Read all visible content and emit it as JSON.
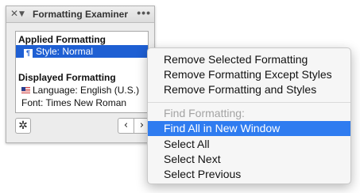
{
  "palette": {
    "title": "Formatting Examiner",
    "close_glyph": "✕",
    "collapse_glyph": "▼",
    "more_glyph": "•••",
    "applied_heading": "Applied Formatting",
    "applied_items": [
      {
        "label": "Style: Normal",
        "icon": "paragraph-style-icon",
        "selected": true
      }
    ],
    "displayed_heading": "Displayed Formatting",
    "displayed_items": [
      {
        "label": "Language: English (U.S.)",
        "icon": "us-flag-icon"
      },
      {
        "label": "Font: Times New Roman"
      }
    ],
    "gear_glyph": "✲",
    "prev_glyph": "‹",
    "next_glyph": "›"
  },
  "context_menu": {
    "items": [
      {
        "label": "Remove Selected Formatting"
      },
      {
        "label": "Remove Formatting Except Styles"
      },
      {
        "label": "Remove Formatting and Styles"
      }
    ],
    "section_header": "Find Formatting:",
    "find_items": [
      {
        "label": "Find All in New Window",
        "highlighted": true
      },
      {
        "label": "Select All"
      },
      {
        "label": "Select Next"
      },
      {
        "label": "Select Previous"
      }
    ]
  },
  "colors": {
    "selection_blue": "#1e5fd3",
    "menu_highlight": "#2f7cf0",
    "disabled_text": "#a3a3a3"
  }
}
